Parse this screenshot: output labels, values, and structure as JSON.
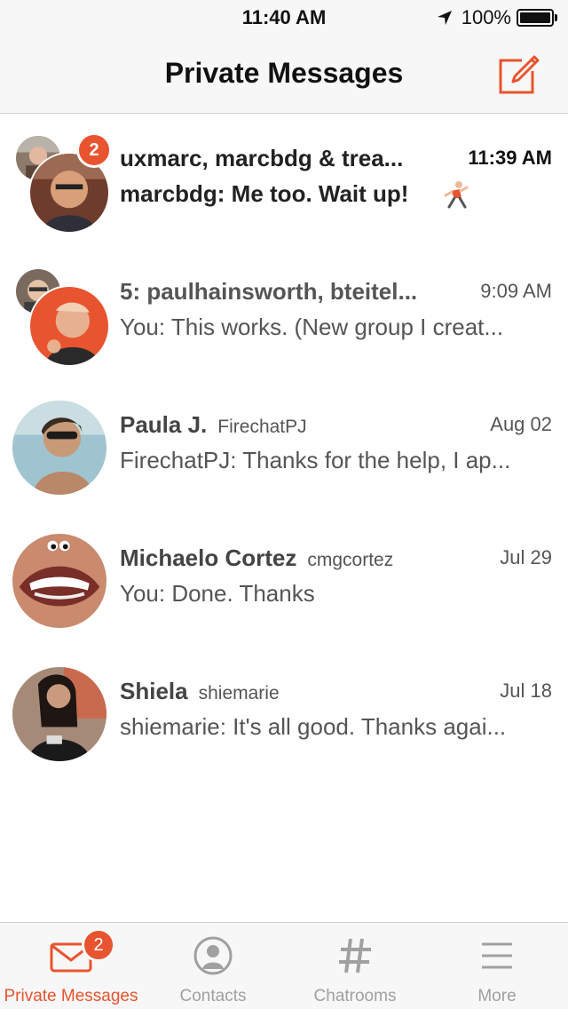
{
  "status_bar": {
    "time": "11:40 AM",
    "battery": "100%",
    "icons": [
      "location-arrow-icon",
      "battery-icon"
    ]
  },
  "nav": {
    "title": "Private Messages",
    "compose_icon": "compose-icon"
  },
  "conversations": [
    {
      "title": "uxmarc, marcbdg & trea...",
      "time": "11:39 AM",
      "preview": "marcbdg: Me too. Wait up!",
      "unread": "2",
      "emoji_icon": "runner-icon"
    },
    {
      "title": "5: paulhainsworth, bteitel...",
      "time": "9:09 AM",
      "preview": "You: This works. (New group I creat..."
    },
    {
      "name": "Paula J.",
      "handle": "FirechatPJ",
      "time": "Aug 02",
      "preview": "FirechatPJ: Thanks for the help, I ap..."
    },
    {
      "name": "Michaelo Cortez",
      "handle": "cmgcortez",
      "time": "Jul 29",
      "preview": "You: Done. Thanks"
    },
    {
      "name": "Shiela",
      "handle": "shiemarie",
      "time": "Jul 18",
      "preview": "shiemarie: It's all good. Thanks agai..."
    }
  ],
  "tabs": [
    {
      "label": "Private Messages",
      "icon": "envelope-icon",
      "badge": "2",
      "active": true
    },
    {
      "label": "Contacts",
      "icon": "contacts-icon"
    },
    {
      "label": "Chatrooms",
      "icon": "hashtag-icon"
    },
    {
      "label": "More",
      "icon": "menu-icon"
    }
  ],
  "colors": {
    "accent": "#e8542f",
    "bar_background": "#f7f7f7",
    "inactive_tab": "#a0a0a0"
  }
}
